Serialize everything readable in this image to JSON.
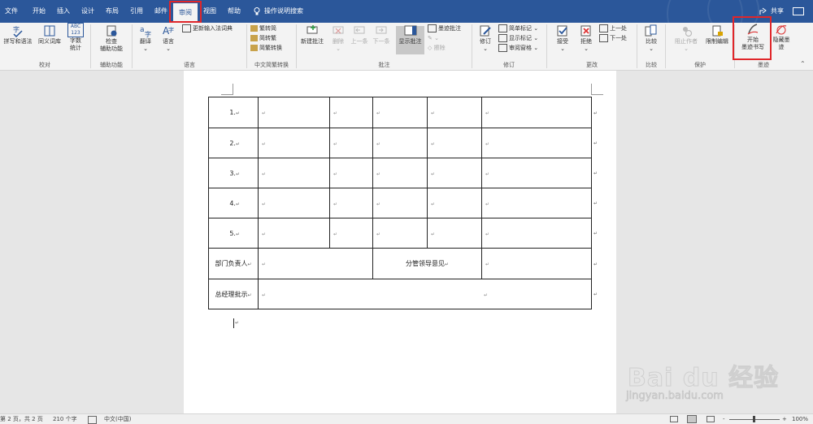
{
  "menubar": {
    "tabs": [
      "文件",
      "开始",
      "插入",
      "设计",
      "布局",
      "引用",
      "邮件",
      "审阅",
      "视图",
      "帮助"
    ],
    "search": "操作说明搜索",
    "share": "共享"
  },
  "ribbon": {
    "proofing": {
      "spell": "拼写和语法",
      "thesaurus": "同义词库",
      "wordcount_top": "字数",
      "wordcount_bottom": "统计",
      "abc": "ABC",
      "num": "123",
      "label": "校对"
    },
    "accessibility": {
      "check_top": "检查",
      "check_bottom": "辅助功能",
      "label": "辅助功能"
    },
    "language": {
      "translate": "翻译",
      "lang": "语言",
      "update_ime": "更新输入法词典",
      "label": "语言"
    },
    "chinese": {
      "t2s": "繁转简",
      "s2t": "简转繁",
      "convert": "简繁转换",
      "label": "中文简繁转换"
    },
    "comments": {
      "new": "新建批注",
      "delete": "删除",
      "prev": "上一条",
      "next": "下一条",
      "show": "显示批注",
      "ink": "墨迹批注",
      "label": "批注"
    },
    "tracking": {
      "track": "修订",
      "simple": "简单标记",
      "showmarkup": "显示标记",
      "pane": "审阅窗格",
      "label": "修订"
    },
    "changes": {
      "accept": "接受",
      "reject": "拒绝",
      "prev": "上一处",
      "next": "下一处",
      "label": "更改"
    },
    "compare": {
      "compare": "比较",
      "label": "比较"
    },
    "protect": {
      "block": "阻止作者",
      "restrict": "限制编辑",
      "label": "保护"
    },
    "ink": {
      "start_top": "开始",
      "start_bottom": "墨迹书写",
      "hide_top": "隐藏墨",
      "hide_bottom": "迹",
      "label": "墨迹"
    }
  },
  "document": {
    "rows": [
      "1.",
      "2.",
      "3.",
      "4.",
      "5."
    ],
    "dept_head": "部门负责人",
    "leader_opinion": "分管领导意见",
    "gm_approval": "总经理批示",
    "mark": "↵"
  },
  "status": {
    "page": "第 2 页，共 2 页",
    "words": "210 个字",
    "lang": "中文(中国)",
    "zoom": "100%",
    "minus": "-",
    "plus": "+"
  },
  "watermark": {
    "brand": "Bai du 经验",
    "url": "jingyan.baidu.com"
  },
  "colors": {
    "brand": "#2b579a",
    "highlight": "#e0262a"
  }
}
